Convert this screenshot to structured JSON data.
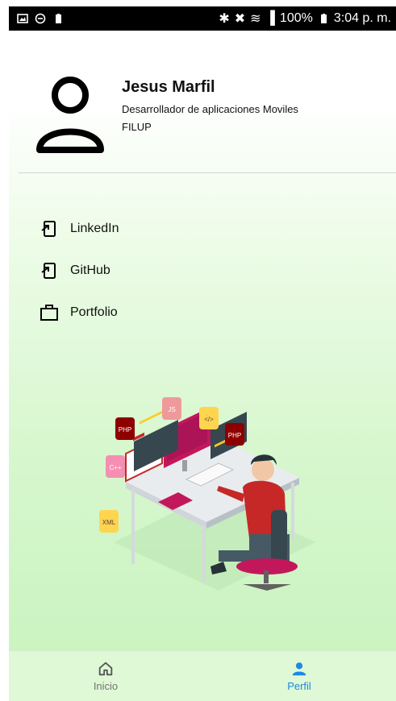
{
  "status_bar": {
    "battery_percent": "100%",
    "time": "3:04 p. m."
  },
  "profile": {
    "name": "Jesus Marfil",
    "role": "Desarrollador de aplicaciones Moviles",
    "organization": "FILUP",
    "avatar_icon": "person-icon"
  },
  "links": [
    {
      "label": "LinkedIn",
      "icon": "open-in-app-icon"
    },
    {
      "label": "GitHub",
      "icon": "open-in-app-icon"
    },
    {
      "label": "Portfolio",
      "icon": "briefcase-icon"
    }
  ],
  "illustration": {
    "badges": [
      "PHP",
      "JS",
      "</>",
      "PHP",
      "C++",
      "XML"
    ]
  },
  "bottom_nav": {
    "items": [
      {
        "label": "Inicio",
        "icon": "home-icon",
        "active": false
      },
      {
        "label": "Perfil",
        "icon": "person-icon",
        "active": true
      }
    ],
    "active_color": "#1e88e5",
    "inactive_color": "#757575"
  }
}
